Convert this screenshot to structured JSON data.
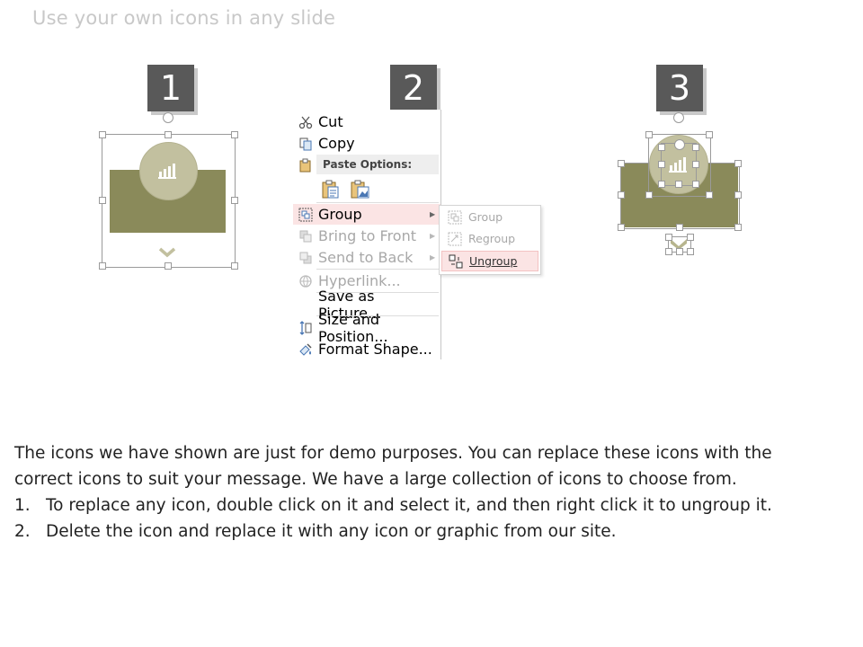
{
  "title": "Use your own icons in any slide",
  "steps": [
    {
      "number": "1"
    },
    {
      "number": "2"
    },
    {
      "number": "3"
    }
  ],
  "context_menu": {
    "items": [
      {
        "label": "Cut",
        "icon": "scissors-icon"
      },
      {
        "label": "Copy",
        "icon": "copy-icon"
      },
      {
        "label": "Paste Options:",
        "icon": "clipboard-icon"
      },
      {
        "label": "Group",
        "icon": "group-icon",
        "has_submenu": true,
        "highlighted": true
      },
      {
        "label": "Bring to Front",
        "icon": "bring-front-icon",
        "has_submenu": true,
        "disabled": true
      },
      {
        "label": "Send to Back",
        "icon": "send-back-icon",
        "has_submenu": true,
        "disabled": true
      },
      {
        "label": "Hyperlink...",
        "icon": "hyperlink-icon",
        "disabled": true
      },
      {
        "label": "Save as Picture...",
        "icon": ""
      },
      {
        "label": "Size and Position...",
        "icon": "size-position-icon"
      },
      {
        "label": "Format Shape...",
        "icon": "format-shape-icon"
      }
    ],
    "submenu": [
      {
        "label": "Group",
        "icon": "group-icon",
        "disabled": true
      },
      {
        "label": "Regroup",
        "icon": "regroup-icon",
        "disabled": true
      },
      {
        "label": "Ungroup",
        "icon": "ungroup-icon",
        "highlighted": true
      }
    ]
  },
  "body": {
    "intro": "The icons we have shown are just for demo purposes. You can replace these icons with the correct icons to suit your message. We have a large collection of icons to choose from.",
    "steps": [
      {
        "num": "1.",
        "text": "To replace any icon, double click on it and select it, and then right click it to ungroup it."
      },
      {
        "num": "2.",
        "text": "Delete the icon and replace it with any icon or graphic from our site."
      }
    ]
  },
  "colors": {
    "olive": "#8a8a5a",
    "olive_light": "#c2c09f",
    "badge": "#595959",
    "highlight": "#fbe4e4"
  }
}
